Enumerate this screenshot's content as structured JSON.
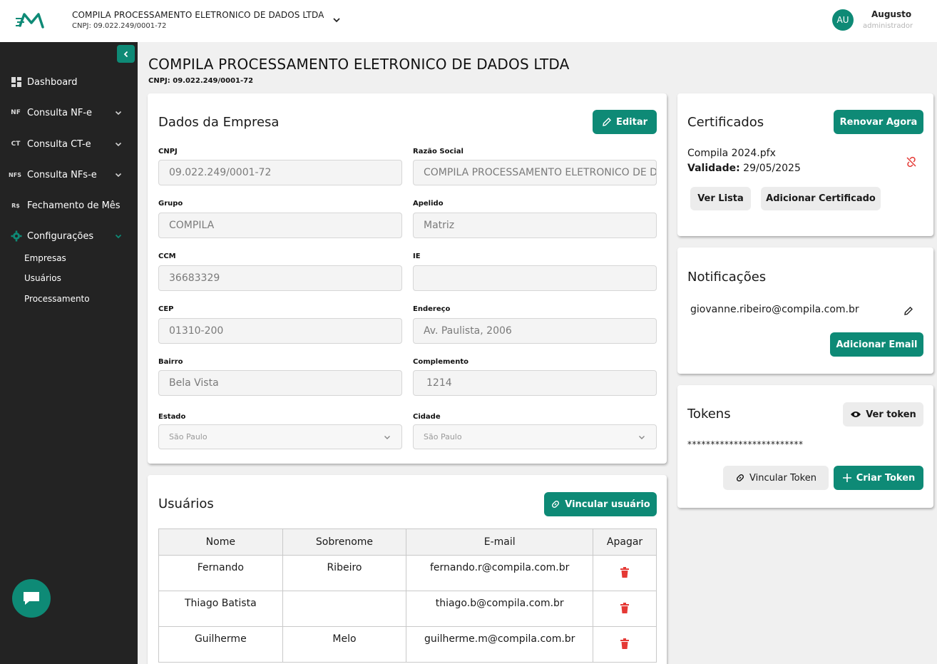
{
  "topbar": {
    "company_name": "COMPILA PROCESSAMENTO ELETRONICO DE DADOS LTDA",
    "company_cnpj": "CNPJ: 09.022.249/0001-72",
    "avatar_initials": "AU",
    "user_name": "Augusto",
    "user_role": "administrador"
  },
  "sidebar": {
    "items": [
      {
        "icon": "dashboard-icon",
        "icon_text": "",
        "label": "Dashboard"
      },
      {
        "icon": "nf-icon",
        "icon_text": "NF",
        "label": "Consulta NF-e"
      },
      {
        "icon": "ct-icon",
        "icon_text": "CT",
        "label": "Consulta CT-e"
      },
      {
        "icon": "nfs-icon",
        "icon_text": "NFS",
        "label": "Consulta NFs-e"
      },
      {
        "icon": "currency-icon",
        "icon_text": "R$",
        "label": "Fechamento de Mês"
      },
      {
        "icon": "gear-icon",
        "icon_text": "",
        "label": "Configurações"
      }
    ],
    "sub_items": [
      "Empresas",
      "Usuários",
      "Processamento"
    ]
  },
  "page": {
    "title": "COMPILA PROCESSAMENTO ELETRONICO DE DADOS LTDA",
    "cnpj": "CNPJ: 09.022.249/0001-72"
  },
  "empresa": {
    "title": "Dados da Empresa",
    "edit_label": "Editar",
    "fields": {
      "cnpj": {
        "label": "CNPJ",
        "value": "09.022.249/0001-72"
      },
      "razao": {
        "label": "Razão Social",
        "value": "COMPILA PROCESSAMENTO ELETRONICO DE DADOS LTDA"
      },
      "grupo": {
        "label": "Grupo",
        "value": "COMPILA"
      },
      "apelido": {
        "label": "Apelido",
        "value": "Matriz"
      },
      "ccm": {
        "label": "CCM",
        "value": "36683329"
      },
      "ie": {
        "label": "IE",
        "value": ""
      },
      "cep": {
        "label": "CEP",
        "value": "01310-200"
      },
      "endereco": {
        "label": "Endereço",
        "value": "Av. Paulista, 2006"
      },
      "bairro": {
        "label": "Bairro",
        "value": "Bela Vista"
      },
      "complemento": {
        "label": "Complemento",
        "value": "1214"
      },
      "estado": {
        "label": "Estado",
        "value": "São Paulo"
      },
      "cidade": {
        "label": "Cidade",
        "value": "São Paulo"
      }
    }
  },
  "usuarios": {
    "title": "Usuários",
    "link_label": "Vincular usuário",
    "columns": [
      "Nome",
      "Sobrenome",
      "E-mail",
      "Apagar"
    ],
    "rows": [
      {
        "nome": "Fernando",
        "sobrenome": "Ribeiro",
        "email": "fernando.r@compila.com.br"
      },
      {
        "nome": "Thiago Batista",
        "sobrenome": "",
        "email": "thiago.b@compila.com.br"
      },
      {
        "nome": "Guilherme",
        "sobrenome": "Melo",
        "email": "guilherme.m@compila.com.br"
      }
    ]
  },
  "certificados": {
    "title": "Certificados",
    "renew_label": "Renovar Agora",
    "file": "Compila 2024.pfx",
    "validity_label": "Validade:",
    "validity_value": "29/05/2025",
    "list_label": "Ver Lista",
    "add_label": "Adicionar Certificado"
  },
  "notificacoes": {
    "title": "Notificações",
    "email": "giovanne.ribeiro@compila.com.br",
    "add_label": "Adicionar Email"
  },
  "tokens": {
    "title": "Tokens",
    "view_label": "Ver token",
    "mask": "*************************",
    "link_label": "Vincular Token",
    "create_label": "Criar Token"
  },
  "colors": {
    "accent": "#0e8a76",
    "sidebar_bg": "#232323",
    "danger": "#e53935"
  }
}
